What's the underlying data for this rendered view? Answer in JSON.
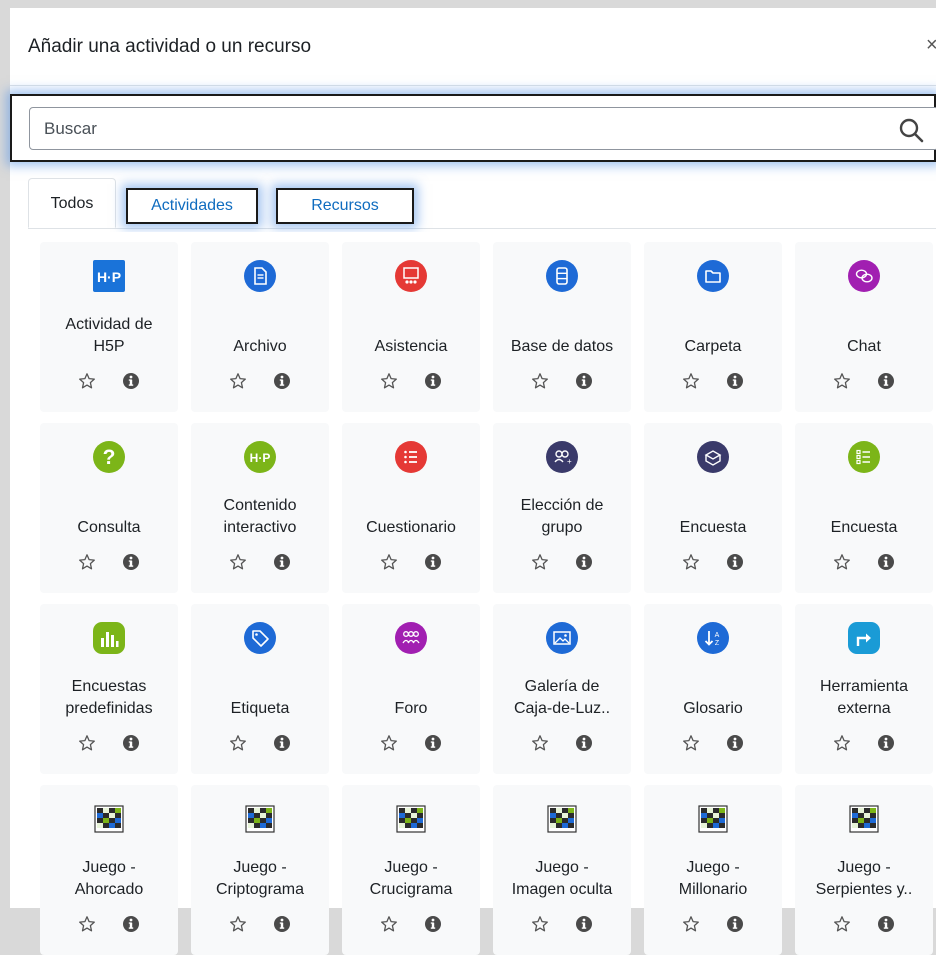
{
  "modal": {
    "title": "Añadir una actividad o un recurso",
    "close": "×"
  },
  "search": {
    "placeholder": "Buscar"
  },
  "tabs": [
    {
      "label": "Todos"
    },
    {
      "label": "Actividades"
    },
    {
      "label": "Recursos"
    }
  ],
  "colors": {
    "link_blue": "#0f6cbf",
    "highlight_glow": "#5a96e6",
    "card_bg": "#f8f9fa"
  },
  "items": [
    {
      "label": "Actividad de\nH5P",
      "icon": "h5p-icon"
    },
    {
      "label": "Archivo",
      "icon": "file-icon"
    },
    {
      "label": "Asistencia",
      "icon": "attendance-icon"
    },
    {
      "label": "Base de datos",
      "icon": "database-icon"
    },
    {
      "label": "Carpeta",
      "icon": "folder-icon"
    },
    {
      "label": "Chat",
      "icon": "chat-icon"
    },
    {
      "label": "Consulta",
      "icon": "question-icon"
    },
    {
      "label": "Contenido\ninteractivo",
      "icon": "h5p-interactive-icon"
    },
    {
      "label": "Cuestionario",
      "icon": "quiz-icon"
    },
    {
      "label": "Elección de\ngrupo",
      "icon": "group-choice-icon"
    },
    {
      "label": "Encuesta",
      "icon": "survey-box-icon"
    },
    {
      "label": "Encuesta",
      "icon": "feedback-list-icon"
    },
    {
      "label": "Encuestas\npredefinidas",
      "icon": "bar-chart-icon"
    },
    {
      "label": "Etiqueta",
      "icon": "tag-icon"
    },
    {
      "label": "Foro",
      "icon": "forum-icon"
    },
    {
      "label": "Galería de\nCaja-de-Luz..",
      "icon": "lightbox-gallery-icon"
    },
    {
      "label": "Glosario",
      "icon": "glossary-icon"
    },
    {
      "label": "Herramienta\nexterna",
      "icon": "external-tool-icon"
    },
    {
      "label": "Juego -\nAhorcado",
      "icon": "game-board-icon"
    },
    {
      "label": "Juego -\nCriptograma",
      "icon": "game-board-icon"
    },
    {
      "label": "Juego -\nCrucigrama",
      "icon": "game-board-icon"
    },
    {
      "label": "Juego -\nImagen oculta",
      "icon": "game-board-icon"
    },
    {
      "label": "Juego -\nMillonario",
      "icon": "game-board-icon"
    },
    {
      "label": "Juego -\nSerpientes y..",
      "icon": "game-board-icon"
    }
  ]
}
